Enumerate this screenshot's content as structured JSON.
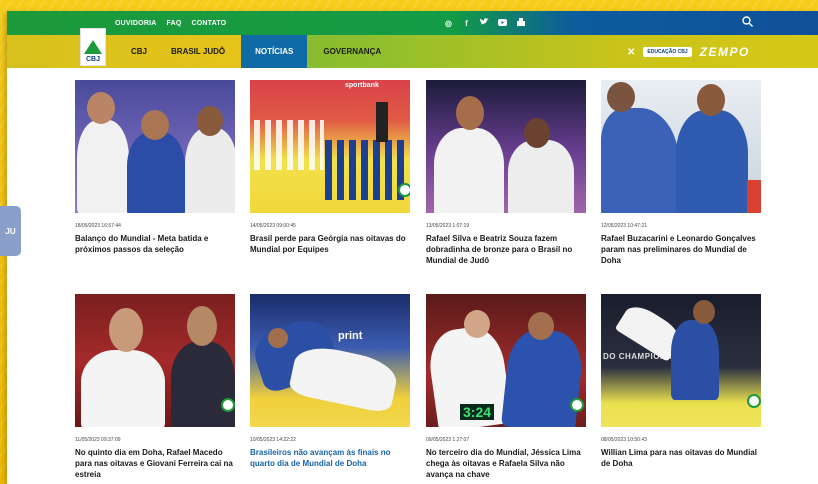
{
  "top_links": [
    "OUVIDORIA",
    "FAQ",
    "CONTATO"
  ],
  "socials": [
    {
      "icon": "instagram-icon",
      "glyph": "◎"
    },
    {
      "icon": "facebook-icon",
      "glyph": "f"
    },
    {
      "icon": "twitter-icon",
      "glyph": "🐦"
    },
    {
      "icon": "youtube-icon",
      "glyph": "▶"
    },
    {
      "icon": "flickr-icon",
      "glyph": "▲"
    }
  ],
  "logo_text": "CBJ",
  "nav": [
    "CBJ",
    "BRASIL JUDÔ",
    "NOTÍCIAS",
    "GOVERNANÇA"
  ],
  "brand_right": {
    "edu": "EDUCAÇÃO CBJ",
    "zempo": "ZEMPO"
  },
  "side_tab": "JU",
  "news": [
    {
      "date": "18/05/2023 16:57:44",
      "title": "Balanço do Mundial - Meta batida e próximos passos da seleção",
      "highlight": false
    },
    {
      "date": "14/05/2023 09:00:45",
      "title": "Brasil perde para Geórgia nas oitavas do Mundial por Equipes",
      "highlight": false
    },
    {
      "date": "13/05/2023 1:07:19",
      "title": "Rafael Silva e Beatriz Souza fazem dobradinha de bronze para o Brasil no Mundial de Judô",
      "highlight": false
    },
    {
      "date": "12/05/2023 10:47:21",
      "title": "Rafael Buzacarini e Leonardo Gonçalves param nas preliminares do Mundial de Doha",
      "highlight": false
    },
    {
      "date": "11/05/2023 09:37:09",
      "title": "No quinto dia em Doha, Rafael Macedo para nas oitavas e Giovani Ferreira cai na estreia",
      "highlight": false
    },
    {
      "date": "10/05/2023 14:22:22",
      "title": "Brasileiros não avançam às finais no quarto dia de Mundial de Doha",
      "highlight": true
    },
    {
      "date": "09/05/2023 1:27:07",
      "title": "No terceiro dia do Mundial, Jéssica Lima chega às oitavas e Rafaela Silva não avança na chave",
      "highlight": false
    },
    {
      "date": "08/05/2023 10:50:43",
      "title": "Willian Lima para nas oitavas do Mundial de Doha",
      "highlight": false
    }
  ],
  "thumb_text": {
    "t2": "sportbank",
    "t6": "print",
    "t7": "3:24",
    "t8": "DO CHAMPIONSHIPS"
  },
  "colors": {
    "green": "#1d9a3a",
    "blue": "#0f6aa6",
    "yellow": "#f4c20d",
    "title_blue": "#1664a8"
  }
}
